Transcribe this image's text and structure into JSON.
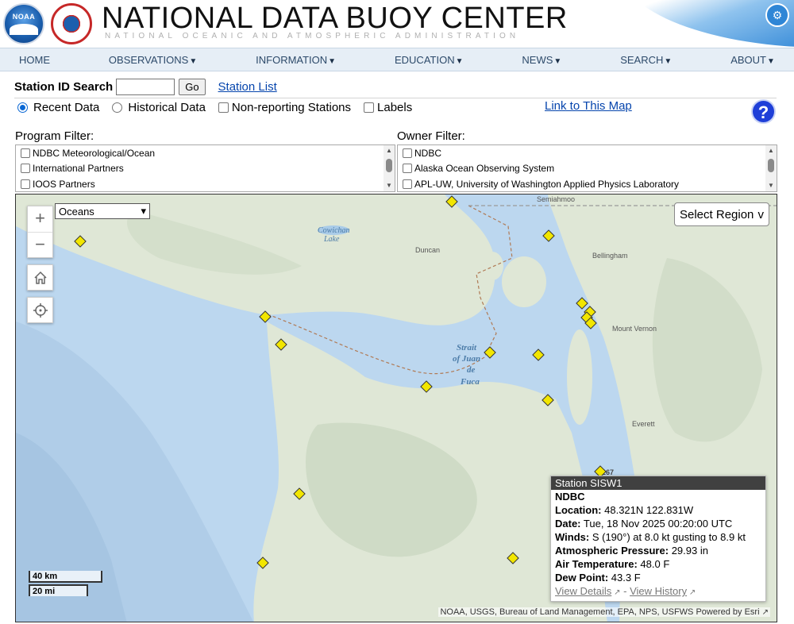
{
  "header": {
    "title": "NATIONAL DATA BUOY CENTER",
    "subtitle": "NATIONAL OCEANIC AND ATMOSPHERIC ADMINISTRATION",
    "noaa_logo_text": "NOAA"
  },
  "nav": {
    "items": [
      {
        "label": "HOME",
        "dropdown": false
      },
      {
        "label": "OBSERVATIONS",
        "dropdown": true
      },
      {
        "label": "INFORMATION",
        "dropdown": true
      },
      {
        "label": "EDUCATION",
        "dropdown": true
      },
      {
        "label": "NEWS",
        "dropdown": true
      },
      {
        "label": "SEARCH",
        "dropdown": true
      },
      {
        "label": "ABOUT",
        "dropdown": true
      }
    ],
    "arrow": "▼"
  },
  "search": {
    "label": "Station ID Search",
    "value": "",
    "go_label": "Go",
    "station_list_label": "Station List"
  },
  "options": {
    "recent_data": "Recent Data",
    "historical_data": "Historical Data",
    "non_reporting": "Non-reporting Stations",
    "labels": "Labels",
    "map_link": "Link to This Map",
    "help": "?"
  },
  "program_filter": {
    "label": "Program Filter:",
    "items": [
      "NDBC Meteorological/Ocean",
      "International Partners",
      "IOOS Partners"
    ]
  },
  "owner_filter": {
    "label": "Owner Filter:",
    "items": [
      "NDBC",
      "Alaska Ocean Observing System",
      "APL-UW, University of Washington Applied Physics Laboratory"
    ]
  },
  "map": {
    "layer": "Oceans",
    "region": "Select Region",
    "region_chevron": "v",
    "scale_km": "40 km",
    "scale_mi": "20 mi",
    "attribution": "NOAA, USGS, Bureau of Land Management, EPA, NPS, USFWS",
    "powered_by": "Powered by Esri",
    "labels": {
      "semiahmoo": "Semiahmoo",
      "cowichan": "Cowichan",
      "lake": "Lake",
      "duncan": "Duncan",
      "bellingham": "Bellingham",
      "mount_vernon": "Mount Vernon",
      "strait1": "Strait",
      "strait2": "of Juan",
      "strait3": "de",
      "strait4": "Fuca",
      "everett": "Everett",
      "road": "267"
    },
    "colors": {
      "water": "#bcd7ef",
      "land": "#dfe7d6",
      "buoy": "#f2e600"
    }
  },
  "popup": {
    "title": "Station SISW1",
    "owner": "NDBC",
    "location_label": "Location:",
    "location": "48.321N 122.831W",
    "date_label": "Date:",
    "date": "Tue, 18 Nov 2025 00:20:00 UTC",
    "winds_label": "Winds:",
    "winds": "S (190°) at 8.0 kt gusting to 8.9 kt",
    "pressure_label": "Atmospheric Pressure:",
    "pressure": "29.93 in",
    "air_temp_label": "Air Temperature:",
    "air_temp": "48.0 F",
    "dew_label": "Dew Point:",
    "dew": "43.3 F",
    "details_label": "View Details",
    "separator": "-",
    "history_label": "View History"
  }
}
